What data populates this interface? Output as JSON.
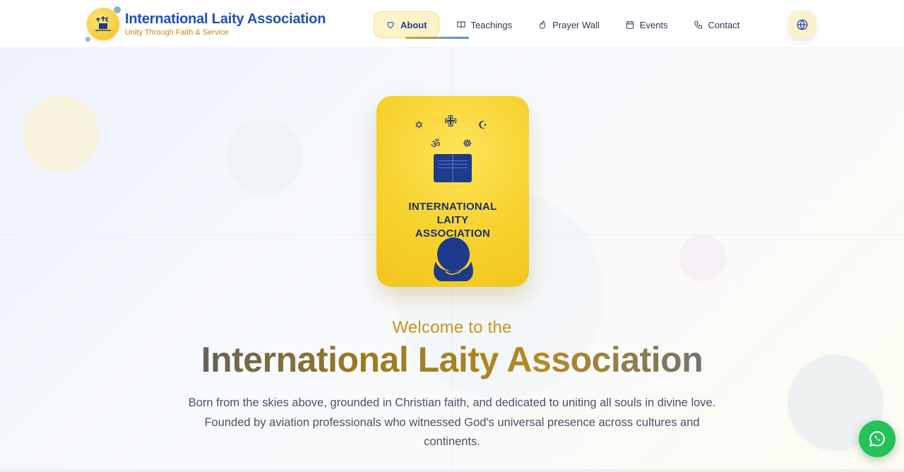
{
  "header": {
    "brand_title": "International Laity Association",
    "brand_subtitle": "Unity Through Faith & Service",
    "logo_text": "INTERNATIONAL LAITY ASSOCIATION",
    "nav": [
      {
        "label": "About",
        "icon": "heart-icon",
        "active": true
      },
      {
        "label": "Teachings",
        "icon": "book-open-icon",
        "active": false
      },
      {
        "label": "Prayer Wall",
        "icon": "flame-icon",
        "active": false
      },
      {
        "label": "Events",
        "icon": "calendar-icon",
        "active": false
      },
      {
        "label": "Contact",
        "icon": "phone-icon",
        "active": false
      }
    ],
    "language_button_icon": "globe-icon"
  },
  "hero": {
    "card": {
      "symbols": [
        "✡",
        "✙",
        "☪",
        "ॐ",
        "☸"
      ],
      "title_lines": [
        "INTERNATIONAL",
        "LAITY",
        "ASSOCIATION"
      ]
    },
    "welcome": "Welcome to the",
    "title": "International Laity Association",
    "description": "Born from the skies above, grounded in Christian faith, and dedicated to uniting all souls in divine love. Founded by aviation professionals who witnessed God's universal presence across cultures and continents."
  },
  "floating": {
    "whatsapp_icon": "whatsapp-icon"
  },
  "colors": {
    "brand_blue": "#1f4fb7",
    "accent_gold": "#c9941e",
    "card_yellow": "#f7d12c",
    "whatsapp_green": "#25c25a"
  }
}
